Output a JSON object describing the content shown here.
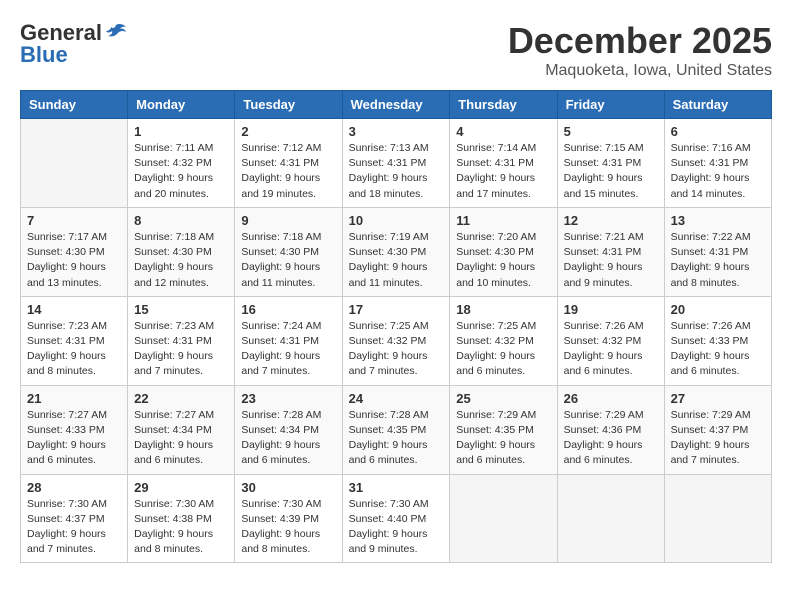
{
  "header": {
    "logo_general": "General",
    "logo_blue": "Blue",
    "month_title": "December 2025",
    "location": "Maquoketa, Iowa, United States"
  },
  "days_of_week": [
    "Sunday",
    "Monday",
    "Tuesday",
    "Wednesday",
    "Thursday",
    "Friday",
    "Saturday"
  ],
  "weeks": [
    [
      {
        "day": "",
        "sunrise": "",
        "sunset": "",
        "daylight": ""
      },
      {
        "day": "1",
        "sunrise": "Sunrise: 7:11 AM",
        "sunset": "Sunset: 4:32 PM",
        "daylight": "Daylight: 9 hours and 20 minutes."
      },
      {
        "day": "2",
        "sunrise": "Sunrise: 7:12 AM",
        "sunset": "Sunset: 4:31 PM",
        "daylight": "Daylight: 9 hours and 19 minutes."
      },
      {
        "day": "3",
        "sunrise": "Sunrise: 7:13 AM",
        "sunset": "Sunset: 4:31 PM",
        "daylight": "Daylight: 9 hours and 18 minutes."
      },
      {
        "day": "4",
        "sunrise": "Sunrise: 7:14 AM",
        "sunset": "Sunset: 4:31 PM",
        "daylight": "Daylight: 9 hours and 17 minutes."
      },
      {
        "day": "5",
        "sunrise": "Sunrise: 7:15 AM",
        "sunset": "Sunset: 4:31 PM",
        "daylight": "Daylight: 9 hours and 15 minutes."
      },
      {
        "day": "6",
        "sunrise": "Sunrise: 7:16 AM",
        "sunset": "Sunset: 4:31 PM",
        "daylight": "Daylight: 9 hours and 14 minutes."
      }
    ],
    [
      {
        "day": "7",
        "sunrise": "Sunrise: 7:17 AM",
        "sunset": "Sunset: 4:30 PM",
        "daylight": "Daylight: 9 hours and 13 minutes."
      },
      {
        "day": "8",
        "sunrise": "Sunrise: 7:18 AM",
        "sunset": "Sunset: 4:30 PM",
        "daylight": "Daylight: 9 hours and 12 minutes."
      },
      {
        "day": "9",
        "sunrise": "Sunrise: 7:18 AM",
        "sunset": "Sunset: 4:30 PM",
        "daylight": "Daylight: 9 hours and 11 minutes."
      },
      {
        "day": "10",
        "sunrise": "Sunrise: 7:19 AM",
        "sunset": "Sunset: 4:30 PM",
        "daylight": "Daylight: 9 hours and 11 minutes."
      },
      {
        "day": "11",
        "sunrise": "Sunrise: 7:20 AM",
        "sunset": "Sunset: 4:30 PM",
        "daylight": "Daylight: 9 hours and 10 minutes."
      },
      {
        "day": "12",
        "sunrise": "Sunrise: 7:21 AM",
        "sunset": "Sunset: 4:31 PM",
        "daylight": "Daylight: 9 hours and 9 minutes."
      },
      {
        "day": "13",
        "sunrise": "Sunrise: 7:22 AM",
        "sunset": "Sunset: 4:31 PM",
        "daylight": "Daylight: 9 hours and 8 minutes."
      }
    ],
    [
      {
        "day": "14",
        "sunrise": "Sunrise: 7:23 AM",
        "sunset": "Sunset: 4:31 PM",
        "daylight": "Daylight: 9 hours and 8 minutes."
      },
      {
        "day": "15",
        "sunrise": "Sunrise: 7:23 AM",
        "sunset": "Sunset: 4:31 PM",
        "daylight": "Daylight: 9 hours and 7 minutes."
      },
      {
        "day": "16",
        "sunrise": "Sunrise: 7:24 AM",
        "sunset": "Sunset: 4:31 PM",
        "daylight": "Daylight: 9 hours and 7 minutes."
      },
      {
        "day": "17",
        "sunrise": "Sunrise: 7:25 AM",
        "sunset": "Sunset: 4:32 PM",
        "daylight": "Daylight: 9 hours and 7 minutes."
      },
      {
        "day": "18",
        "sunrise": "Sunrise: 7:25 AM",
        "sunset": "Sunset: 4:32 PM",
        "daylight": "Daylight: 9 hours and 6 minutes."
      },
      {
        "day": "19",
        "sunrise": "Sunrise: 7:26 AM",
        "sunset": "Sunset: 4:32 PM",
        "daylight": "Daylight: 9 hours and 6 minutes."
      },
      {
        "day": "20",
        "sunrise": "Sunrise: 7:26 AM",
        "sunset": "Sunset: 4:33 PM",
        "daylight": "Daylight: 9 hours and 6 minutes."
      }
    ],
    [
      {
        "day": "21",
        "sunrise": "Sunrise: 7:27 AM",
        "sunset": "Sunset: 4:33 PM",
        "daylight": "Daylight: 9 hours and 6 minutes."
      },
      {
        "day": "22",
        "sunrise": "Sunrise: 7:27 AM",
        "sunset": "Sunset: 4:34 PM",
        "daylight": "Daylight: 9 hours and 6 minutes."
      },
      {
        "day": "23",
        "sunrise": "Sunrise: 7:28 AM",
        "sunset": "Sunset: 4:34 PM",
        "daylight": "Daylight: 9 hours and 6 minutes."
      },
      {
        "day": "24",
        "sunrise": "Sunrise: 7:28 AM",
        "sunset": "Sunset: 4:35 PM",
        "daylight": "Daylight: 9 hours and 6 minutes."
      },
      {
        "day": "25",
        "sunrise": "Sunrise: 7:29 AM",
        "sunset": "Sunset: 4:35 PM",
        "daylight": "Daylight: 9 hours and 6 minutes."
      },
      {
        "day": "26",
        "sunrise": "Sunrise: 7:29 AM",
        "sunset": "Sunset: 4:36 PM",
        "daylight": "Daylight: 9 hours and 6 minutes."
      },
      {
        "day": "27",
        "sunrise": "Sunrise: 7:29 AM",
        "sunset": "Sunset: 4:37 PM",
        "daylight": "Daylight: 9 hours and 7 minutes."
      }
    ],
    [
      {
        "day": "28",
        "sunrise": "Sunrise: 7:30 AM",
        "sunset": "Sunset: 4:37 PM",
        "daylight": "Daylight: 9 hours and 7 minutes."
      },
      {
        "day": "29",
        "sunrise": "Sunrise: 7:30 AM",
        "sunset": "Sunset: 4:38 PM",
        "daylight": "Daylight: 9 hours and 8 minutes."
      },
      {
        "day": "30",
        "sunrise": "Sunrise: 7:30 AM",
        "sunset": "Sunset: 4:39 PM",
        "daylight": "Daylight: 9 hours and 8 minutes."
      },
      {
        "day": "31",
        "sunrise": "Sunrise: 7:30 AM",
        "sunset": "Sunset: 4:40 PM",
        "daylight": "Daylight: 9 hours and 9 minutes."
      },
      {
        "day": "",
        "sunrise": "",
        "sunset": "",
        "daylight": ""
      },
      {
        "day": "",
        "sunrise": "",
        "sunset": "",
        "daylight": ""
      },
      {
        "day": "",
        "sunrise": "",
        "sunset": "",
        "daylight": ""
      }
    ]
  ]
}
